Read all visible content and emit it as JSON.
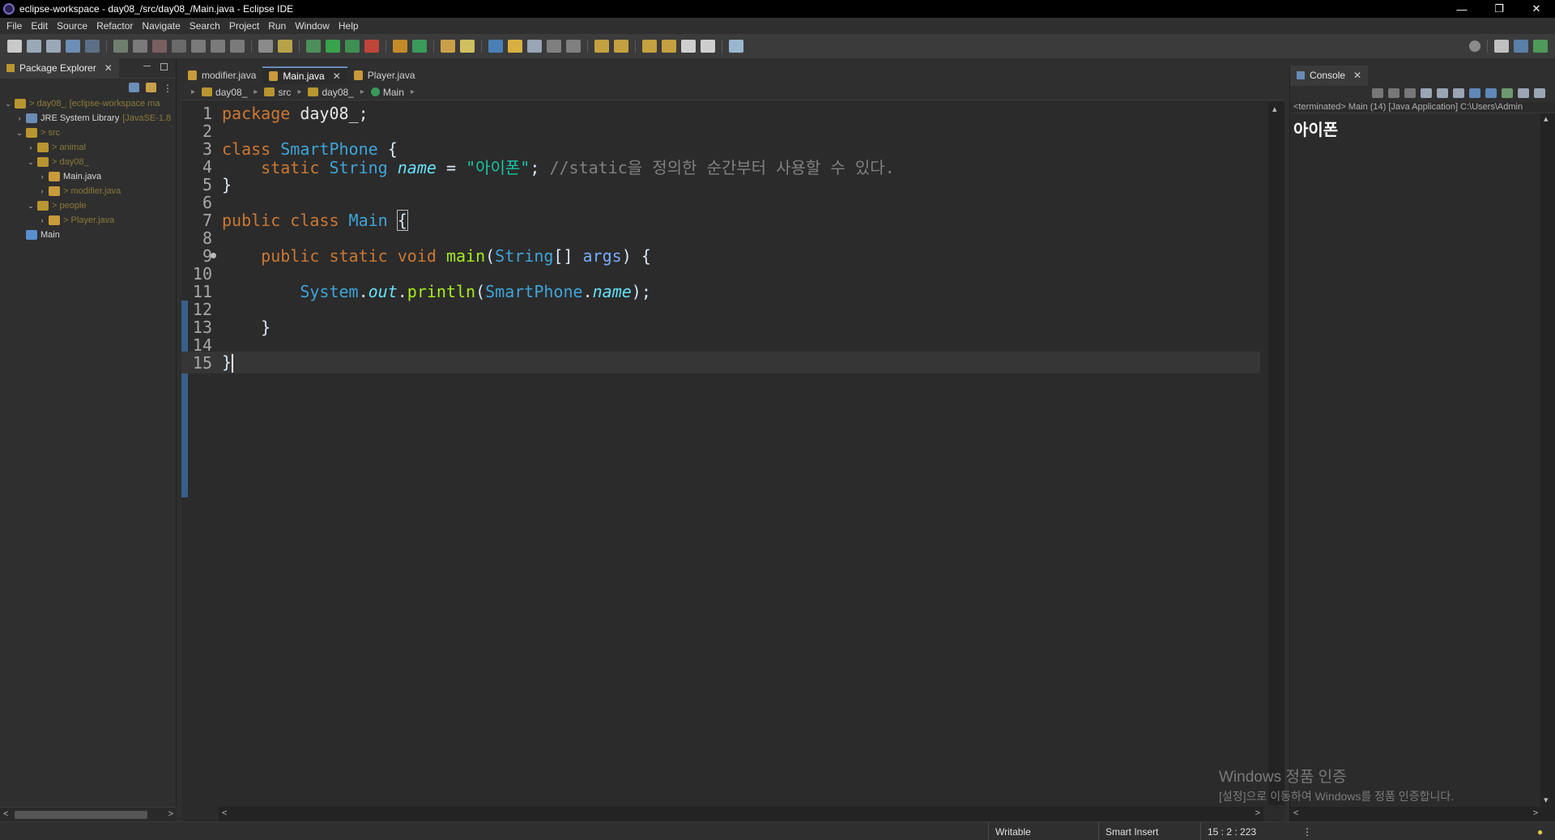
{
  "window": {
    "title": "eclipse-workspace - day08_/src/day08_/Main.java - Eclipse IDE",
    "minimize": "—",
    "restore": "❐",
    "close": "✕"
  },
  "menu": [
    "File",
    "Edit",
    "Source",
    "Refactor",
    "Navigate",
    "Search",
    "Project",
    "Run",
    "Window",
    "Help"
  ],
  "package_explorer": {
    "title": "Package Explorer",
    "tree": [
      {
        "label": "> day08_",
        "dim": "[eclipse-workspace ma",
        "indent": 0,
        "twisty": "v",
        "color": "#8a7a3a"
      },
      {
        "label": "JRE System Library",
        "dim": "[JavaSE-1.8",
        "indent": 1,
        "twisty": ">",
        "color": "#d8d8d8"
      },
      {
        "label": "> src",
        "dim": "",
        "indent": 1,
        "twisty": "v",
        "color": "#8a7a3a"
      },
      {
        "label": "> animal",
        "dim": "",
        "indent": 2,
        "twisty": ">",
        "color": "#8a7a3a"
      },
      {
        "label": "> day08_",
        "dim": "",
        "indent": 2,
        "twisty": "v",
        "color": "#8a7a3a"
      },
      {
        "label": "Main.java",
        "dim": "",
        "indent": 3,
        "twisty": ">",
        "color": "#d8d8d8"
      },
      {
        "label": "> modifier.java",
        "dim": "",
        "indent": 3,
        "twisty": ">",
        "color": "#8a7a3a"
      },
      {
        "label": "> people",
        "dim": "",
        "indent": 2,
        "twisty": "v",
        "color": "#8a7a3a"
      },
      {
        "label": "> Player.java",
        "dim": "",
        "indent": 3,
        "twisty": ">",
        "color": "#8a7a3a"
      },
      {
        "label": "Main",
        "dim": "",
        "indent": 1,
        "twisty": "",
        "color": "#d8d8d8"
      }
    ]
  },
  "editor": {
    "tabs": [
      "modifier.java",
      "Main.java",
      "Player.java"
    ],
    "active_tab": "Main.java",
    "breadcrumb": [
      "day08_",
      "src",
      "day08_",
      "Main"
    ],
    "code": {
      "l1_kw": "package",
      "l1_pkg": " day08_;",
      "l3_kw": "class ",
      "l3_type": "SmartPhone",
      "l3_rest": " {",
      "l4_kw": "static ",
      "l4_type": "String ",
      "l4_field": "name",
      "l4_eq": " = ",
      "l4_str": "\"아이폰\"",
      "l4_semi": "; ",
      "l4_cmt": "//static을 정의한 순간부터 사용할 수 있다.",
      "l5": "}",
      "l7_kw": "public class ",
      "l7_type": "Main",
      "l7_brace": "{",
      "l9_kw": "public static void ",
      "l9_mth": "main",
      "l9_p1": "(",
      "l9_type": "String",
      "l9_p2": "[] ",
      "l9_arg": "args",
      "l9_p3": ") {",
      "l11_type": "System",
      "l11_dot1": ".",
      "l11_field": "out",
      "l11_dot2": ".",
      "l11_mth": "println",
      "l11_p1": "(",
      "l11_type2": "SmartPhone",
      "l11_dot3": ".",
      "l11_field2": "name",
      "l11_end": ");",
      "l13": "}",
      "l15": "}"
    }
  },
  "console": {
    "title": "Console",
    "status": "<terminated> Main (14) [Java Application] C:\\Users\\Admin",
    "output": "아이폰"
  },
  "watermark": {
    "line1": "Windows 정품 인증",
    "line2": "[설정]으로 이동하여 Windows를 정품 인증합니다."
  },
  "statusbar": {
    "writable": "Writable",
    "insert_mode": "Smart Insert",
    "position": "15 : 2 : 223"
  },
  "colors": {
    "keyword": "#cc7832",
    "type": "#3fa4d8",
    "string": "#17c6a3",
    "comment": "#808080",
    "method": "#a7ec21",
    "field": "#66e1f8"
  }
}
